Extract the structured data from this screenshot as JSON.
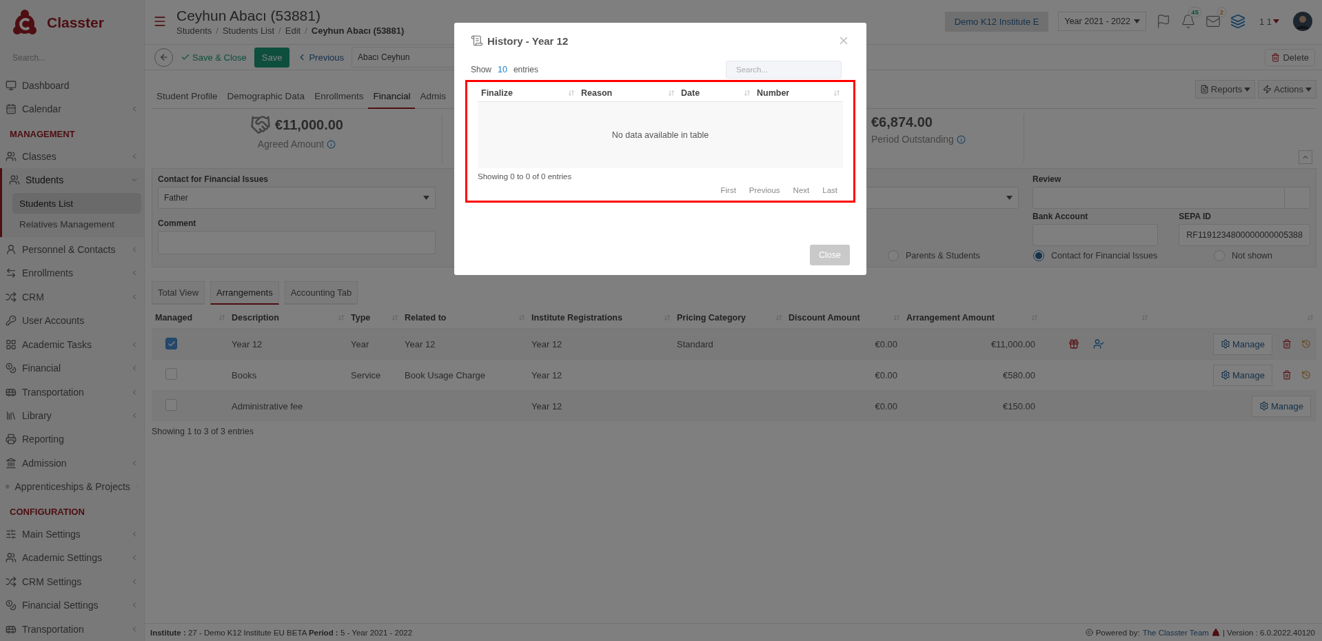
{
  "brand": {
    "name": "Classter"
  },
  "sidebar": {
    "search_placeholder": "Search...",
    "sections": [
      {
        "items": [
          {
            "label": "Dashboard",
            "expandable": false,
            "expanded": false,
            "selected": false
          },
          {
            "label": "Calendar",
            "expandable": true,
            "expanded": false,
            "selected": false
          }
        ]
      },
      {
        "heading": "MANAGEMENT",
        "items": [
          {
            "label": "Classes",
            "expandable": true,
            "expanded": false,
            "selected": false
          },
          {
            "label": "Students",
            "expandable": true,
            "expanded": true,
            "selected": false,
            "children": [
              {
                "label": "Students List",
                "selected": true
              },
              {
                "label": "Relatives Management",
                "selected": false
              }
            ]
          },
          {
            "label": "Personnel & Contacts",
            "expandable": true,
            "expanded": false,
            "selected": false
          },
          {
            "label": "Enrollments",
            "expandable": true,
            "expanded": false,
            "selected": false
          },
          {
            "label": "CRM",
            "expandable": true,
            "expanded": false,
            "selected": false
          },
          {
            "label": "User Accounts",
            "expandable": false,
            "expanded": false,
            "selected": false
          },
          {
            "label": "Academic Tasks",
            "expandable": true,
            "expanded": false,
            "selected": false
          },
          {
            "label": "Financial",
            "expandable": true,
            "expanded": false,
            "selected": false
          },
          {
            "label": "Transportation",
            "expandable": true,
            "expanded": false,
            "selected": false
          },
          {
            "label": "Library",
            "expandable": true,
            "expanded": false,
            "selected": false
          },
          {
            "label": "Reporting",
            "expandable": false,
            "expanded": false,
            "selected": false
          },
          {
            "label": "Admission",
            "expandable": true,
            "expanded": false,
            "selected": false
          },
          {
            "label": "Apprenticeships & Projects",
            "expandable": true,
            "expanded": false,
            "selected": false
          }
        ]
      },
      {
        "heading": "CONFIGURATION",
        "items": [
          {
            "label": "Main Settings",
            "expandable": true,
            "expanded": false,
            "selected": false
          },
          {
            "label": "Academic Settings",
            "expandable": true,
            "expanded": false,
            "selected": false
          },
          {
            "label": "CRM Settings",
            "expandable": true,
            "expanded": false,
            "selected": false
          },
          {
            "label": "Financial Settings",
            "expandable": true,
            "expanded": false,
            "selected": false
          },
          {
            "label": "Transportation",
            "expandable": true,
            "expanded": false,
            "selected": false
          }
        ]
      }
    ]
  },
  "header": {
    "title": "Ceyhun Abacı (53881)",
    "breadcrumb": [
      {
        "kind": "link",
        "text": "Students"
      },
      {
        "kind": "separator",
        "text": "/"
      },
      {
        "kind": "link",
        "text": "Students List"
      },
      {
        "kind": "separator",
        "text": "/"
      },
      {
        "kind": "link",
        "text": "Edit"
      },
      {
        "kind": "separator",
        "text": "/"
      },
      {
        "kind": "current",
        "text": "Ceyhun Abacı (53881)"
      }
    ],
    "institute": "Demo K12 Institute E",
    "year": "Year 2021 - 2022",
    "notifications": "45",
    "messages": "2",
    "user": "1 1"
  },
  "toolbar": {
    "save_close": "Save & Close",
    "save": "Save",
    "previous": "Previous",
    "student": "Abacı Ceyhun",
    "delete": "Delete"
  },
  "tabs": [
    {
      "label": "Student Profile",
      "selected": false
    },
    {
      "label": "Demographic Data",
      "selected": false
    },
    {
      "label": "Enrollments",
      "selected": false
    },
    {
      "label": "Financial",
      "selected": true
    },
    {
      "label": "Admis",
      "selected": false
    }
  ],
  "tab_actions": [
    "Reports",
    "Actions"
  ],
  "summary": [
    {
      "amount": "€11,000.00",
      "label": "Agreed Amount"
    },
    {
      "amount": "€6,874.00",
      "label": "Period Outstanding"
    }
  ],
  "form": {
    "contact_label": "Contact for Financial Issues",
    "contact_value": "Father",
    "review_label": "Review",
    "bank_label": "Bank Account",
    "sepa_label": "SEPA ID",
    "sepa_value": "RF1191234800000000005388",
    "comment_label": "Comment",
    "visibility": [
      {
        "label": "Parents & Students",
        "selected": false
      },
      {
        "label": "Contact for Financial Issues",
        "selected": true
      },
      {
        "label": "Not shown",
        "selected": false
      }
    ]
  },
  "sub_tabs": [
    {
      "label": "Total View",
      "selected": false
    },
    {
      "label": "Arrangements",
      "selected": true
    },
    {
      "label": "Accounting Tab",
      "selected": false
    }
  ],
  "arrangements": {
    "columns": [
      "Managed",
      "Description",
      "Type",
      "Related to",
      "Institute Registrations",
      "Pricing Category",
      "Discount Amount",
      "Arrangement Amount"
    ],
    "rows": [
      {
        "managed": true,
        "description": "Year 12",
        "type": "Year",
        "related_to": "Year 12",
        "registrations": "Year 12",
        "pricing": "Standard",
        "discount": "€0.00",
        "amount": "€11,000.00",
        "extras": true,
        "removable": true,
        "manage": "Manage"
      },
      {
        "managed": false,
        "description": "Books",
        "type": "Service",
        "related_to": "Book Usage Charge",
        "registrations": "Year 12",
        "discount": "€0.00",
        "amount": "€580.00",
        "extras": false,
        "removable": true,
        "manage": "Manage"
      },
      {
        "managed": false,
        "description": "Administrative fee",
        "registrations": "Year 12",
        "discount": "€0.00",
        "amount": "€150.00",
        "extras": false,
        "removable": false,
        "manage": "Manage"
      }
    ],
    "info": "Showing 1 to 3 of 3 entries"
  },
  "footer": {
    "context": "**Institute :** 27 - Demo K12 Institute EU BETA **Period :** 5 - Year 2021 - 2022",
    "powered": "Powered by:",
    "team": "The Classter Team",
    "version": "| Version : 6.0.2022.40120"
  },
  "modal": {
    "title": "History - Year 12",
    "show": "Show",
    "page_size": "10",
    "entries": "entries",
    "search_placeholder": "Search...",
    "highlighted": true,
    "columns": [
      "Finalize",
      "Reason",
      "Date",
      "Number"
    ],
    "empty": "No data available in table",
    "info": "Showing 0 to 0 of 0 entries",
    "pages": [
      {
        "label": "First",
        "disabled": true
      },
      {
        "label": "Previous",
        "disabled": true
      },
      {
        "label": "Next",
        "disabled": true
      },
      {
        "label": "Last",
        "disabled": true
      }
    ],
    "close": {
      "label": "Close",
      "disabled": true
    }
  }
}
